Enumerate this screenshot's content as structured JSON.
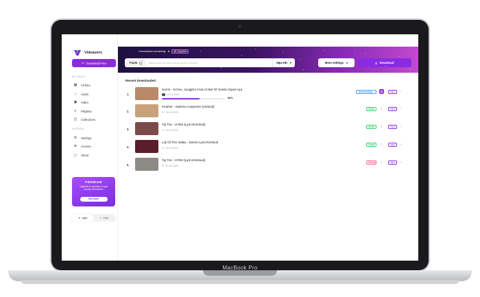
{
  "device": {
    "brand_label": "MacBook Pro"
  },
  "window": {
    "dot_colors": [
      "#ff5f57",
      "#febc2e",
      "#28c840"
    ]
  },
  "app": {
    "name": "Vidsavers",
    "accent": "#8a2be2"
  },
  "sidebar": {
    "download_free_label": "Download Free",
    "my_files_title": "MY FILES",
    "file_items": [
      {
        "label": "All files",
        "icon": "grid-icon"
      },
      {
        "label": "Audio",
        "icon": "music-note-icon"
      },
      {
        "label": "Video",
        "icon": "video-icon"
      },
      {
        "label": "Playlists",
        "icon": "playlist-icon"
      },
      {
        "label": "Collections",
        "icon": "collections-icon"
      }
    ],
    "system_title": "SYSTEM",
    "system_items": [
      {
        "label": "Settings",
        "icon": "gear-icon"
      },
      {
        "label": "License",
        "icon": "license-icon"
      },
      {
        "label": "About",
        "icon": "info-icon"
      }
    ],
    "promo": {
      "title": "PREMIUM",
      "description": "Upgrade to premium to get access all features",
      "button_label": "Get now!"
    },
    "theme": {
      "light_label": "Light",
      "dark_label": "Dark",
      "active": "light"
    }
  },
  "header": {
    "conversions_label": "Conversions remaining:",
    "conversions_count": "3",
    "upgrade_label": "Upgrade",
    "paste_label": "Paste",
    "input_placeholder": "paste your link and choose type to convert",
    "quality_value": "Mp4 HD",
    "more_settings_label": "More settings",
    "download_label": "Download"
  },
  "recent": {
    "title": "Recent Downloaded",
    "items": [
      {
        "num": "1.",
        "title": "Sorrie - SoYou, JungjiDo Feat Lil Bel Of Geeks (Sped Up)",
        "date": "10-10-2023",
        "status": "Downloading...",
        "status_type": "downloading",
        "format": "mp4",
        "progress": 0.6,
        "progress_label": "60%",
        "thumb": "#b88a6a"
      },
      {
        "num": "2.",
        "title": "Feather - Sabrina Carpenter [Vietsub]",
        "date": "10-10-2023",
        "status": "Done",
        "status_type": "done",
        "format": "mp4",
        "thumb": "#c9a27c"
      },
      {
        "num": "3.",
        "title": "Tip Toe - HYBS [Lyrics/Vietsub]",
        "date": "10-10-2023",
        "status": "Done",
        "status_type": "done",
        "format": "mp4",
        "thumb": "#7a4b4a"
      },
      {
        "num": "4.",
        "title": "Lily Of The Valley - Daniel Lyrics/Vietsub",
        "date": "10-10-2023",
        "status": "Done",
        "status_type": "done",
        "format": "mp4",
        "thumb": "#5a1e2a"
      },
      {
        "num": "5.",
        "title": "Tip Toe - HYBS [Lyrics/Vietsub]",
        "date": "10-10-2023",
        "status": "Paused",
        "status_type": "paused",
        "format": "mp4",
        "thumb": "#8d8a86"
      }
    ]
  }
}
